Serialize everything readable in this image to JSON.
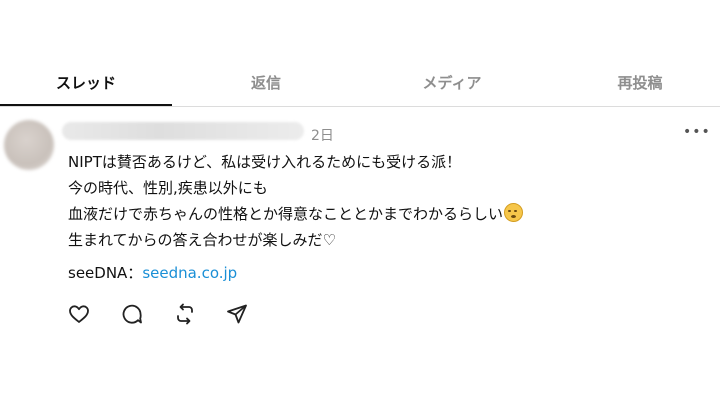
{
  "tabs": [
    {
      "label": "スレッド",
      "active": true
    },
    {
      "label": "返信",
      "active": false
    },
    {
      "label": "メディア",
      "active": false
    },
    {
      "label": "再投稿",
      "active": false
    }
  ],
  "post": {
    "time": "2日",
    "more_label": "•••",
    "lines": [
      "NIPTは賛否あるけど、私は受け入れるためにも受ける派！",
      "今の時代、性別,疾患以外にも",
      "血液だけで赤ちゃんの性格とか得意なこととかまでわかるらしい",
      "生まれてからの答え合わせが楽しみだ♡"
    ],
    "link_prefix": "seeDNA：",
    "link_text": "seedna.co.jp"
  },
  "icons": [
    "heart-icon",
    "comment-icon",
    "repost-icon",
    "share-icon"
  ],
  "colors": {
    "link": "#1a8fd6",
    "muted": "#8e8e8e",
    "text": "#111111"
  }
}
